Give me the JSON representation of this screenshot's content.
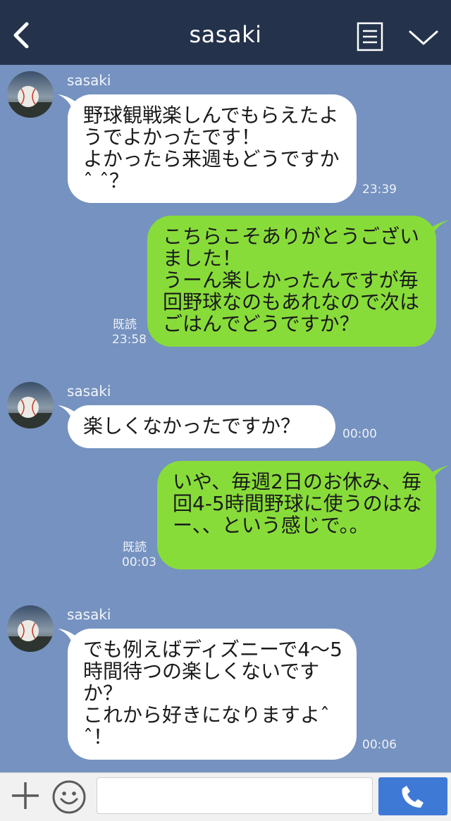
{
  "header": {
    "title": "sasaki"
  },
  "messages": [
    {
      "sender": "sasaki",
      "text": "野球観戦楽しんでもらえたようでよかったです！\nよかったら来週もどうですかˆ ˆ？",
      "time": "23:39"
    },
    {
      "read": "既読",
      "text": "こちらこそありがとうございました！\nうーん楽しかったんですが毎回野球なのもあれなので次はごはんでどうですか？",
      "time": "23:58"
    },
    {
      "sender": "sasaki",
      "text": "楽しくなかったですか？",
      "time": "00:00"
    },
    {
      "read": "既読",
      "text": "いや、毎週2日のお休み、毎回4-5時間野球に使うのはなー、、という感じで。。",
      "time": "00:03"
    },
    {
      "sender": "sasaki",
      "text": "でも例えばディズニーで4〜5時間待つの楽しくないですか？\nこれから好きになりますよˆ ˆ！",
      "time": "00:06"
    }
  ],
  "footer": {
    "input_placeholder": ""
  },
  "colors": {
    "header_bg": "#24324b",
    "chat_bg": "#7592c0",
    "outgoing_bubble": "#88dc3a",
    "incoming_bubble": "#ffffff",
    "call_button": "#3f79d6"
  },
  "icons": [
    "back-icon",
    "notes-icon",
    "chevron-down-icon",
    "plus-icon",
    "smile-icon",
    "phone-icon"
  ]
}
